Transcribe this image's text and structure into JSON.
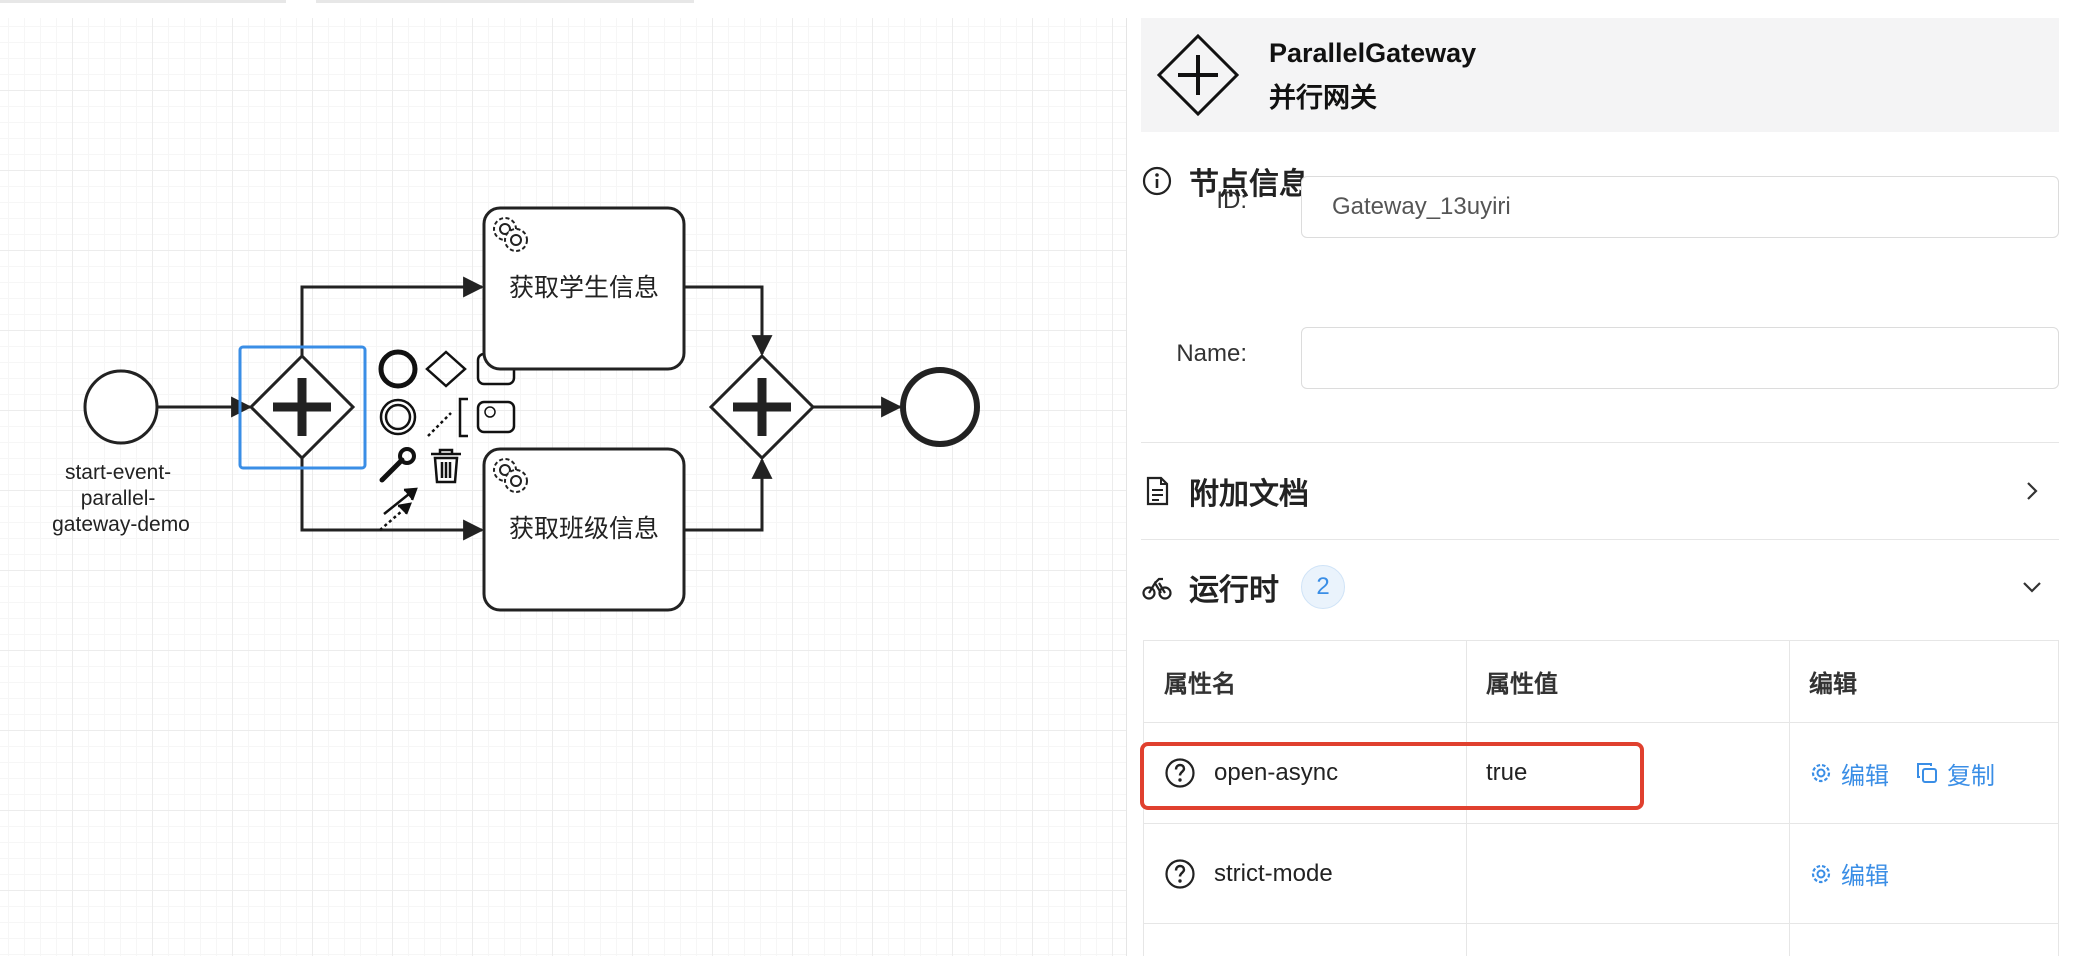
{
  "diagram": {
    "start_event_label_lines": [
      "start-event-",
      "parallel-",
      "gateway-demo"
    ],
    "task_1_label": "获取学生信息",
    "task_2_label": "获取班级信息"
  },
  "panel": {
    "element_type": "ParallelGateway",
    "element_name": "并行网关",
    "groups": {
      "general": {
        "title": "节点信息",
        "id_label": "ID:",
        "id_value": "Gateway_13uyiri",
        "name_label": "Name:",
        "name_value": ""
      },
      "documentation": {
        "title": "附加文档"
      },
      "runtime": {
        "title": "运行时",
        "count": "2",
        "columns": [
          "属性名",
          "属性值",
          "编辑"
        ],
        "rows": [
          {
            "name": "open-async",
            "value": "true",
            "actions": [
              "编辑",
              "复制"
            ]
          },
          {
            "name": "strict-mode",
            "value": "",
            "actions": [
              "编辑"
            ]
          }
        ]
      }
    }
  },
  "colors": {
    "selection": "#3a8ee6",
    "link": "#3a8ee6",
    "highlight": "#e0402e"
  }
}
